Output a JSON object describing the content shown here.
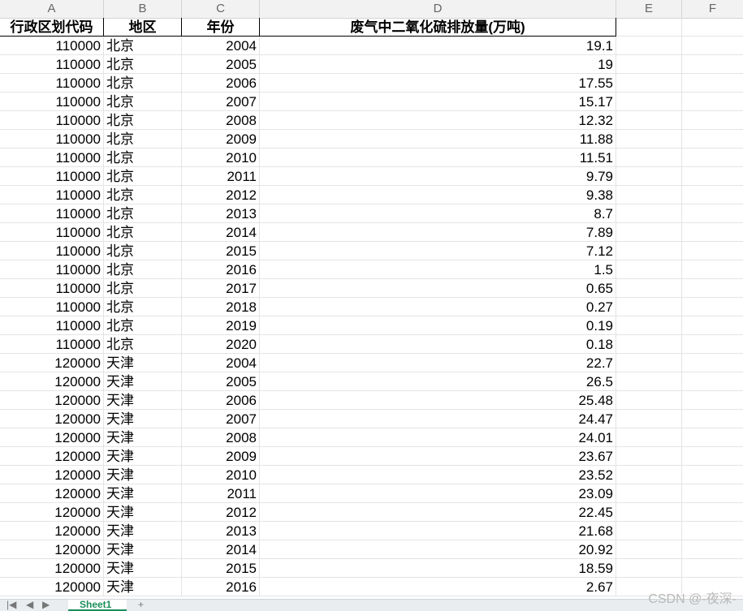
{
  "column_headers": [
    "A",
    "B",
    "C",
    "D",
    "E",
    "F"
  ],
  "table": {
    "headers": [
      "行政区划代码",
      "地区",
      "年份",
      "废气中二氧化硫排放量(万吨)"
    ],
    "rows": [
      [
        "110000",
        "北京",
        "2004",
        "19.1"
      ],
      [
        "110000",
        "北京",
        "2005",
        "19"
      ],
      [
        "110000",
        "北京",
        "2006",
        "17.55"
      ],
      [
        "110000",
        "北京",
        "2007",
        "15.17"
      ],
      [
        "110000",
        "北京",
        "2008",
        "12.32"
      ],
      [
        "110000",
        "北京",
        "2009",
        "11.88"
      ],
      [
        "110000",
        "北京",
        "2010",
        "11.51"
      ],
      [
        "110000",
        "北京",
        "2011",
        "9.79"
      ],
      [
        "110000",
        "北京",
        "2012",
        "9.38"
      ],
      [
        "110000",
        "北京",
        "2013",
        "8.7"
      ],
      [
        "110000",
        "北京",
        "2014",
        "7.89"
      ],
      [
        "110000",
        "北京",
        "2015",
        "7.12"
      ],
      [
        "110000",
        "北京",
        "2016",
        "1.5"
      ],
      [
        "110000",
        "北京",
        "2017",
        "0.65"
      ],
      [
        "110000",
        "北京",
        "2018",
        "0.27"
      ],
      [
        "110000",
        "北京",
        "2019",
        "0.19"
      ],
      [
        "110000",
        "北京",
        "2020",
        "0.18"
      ],
      [
        "120000",
        "天津",
        "2004",
        "22.7"
      ],
      [
        "120000",
        "天津",
        "2005",
        "26.5"
      ],
      [
        "120000",
        "天津",
        "2006",
        "25.48"
      ],
      [
        "120000",
        "天津",
        "2007",
        "24.47"
      ],
      [
        "120000",
        "天津",
        "2008",
        "24.01"
      ],
      [
        "120000",
        "天津",
        "2009",
        "23.67"
      ],
      [
        "120000",
        "天津",
        "2010",
        "23.52"
      ],
      [
        "120000",
        "天津",
        "2011",
        "23.09"
      ],
      [
        "120000",
        "天津",
        "2012",
        "22.45"
      ],
      [
        "120000",
        "天津",
        "2013",
        "21.68"
      ],
      [
        "120000",
        "天津",
        "2014",
        "20.92"
      ],
      [
        "120000",
        "天津",
        "2015",
        "18.59"
      ],
      [
        "120000",
        "天津",
        "2016",
        "2.67"
      ]
    ]
  },
  "sheet_tab": "Sheet1",
  "watermark": "CSDN @-夜深-",
  "colors": {
    "header_bg": "#f2f2f2",
    "grid": "#e4e4e4",
    "tab_accent": "#1a8f5a"
  }
}
